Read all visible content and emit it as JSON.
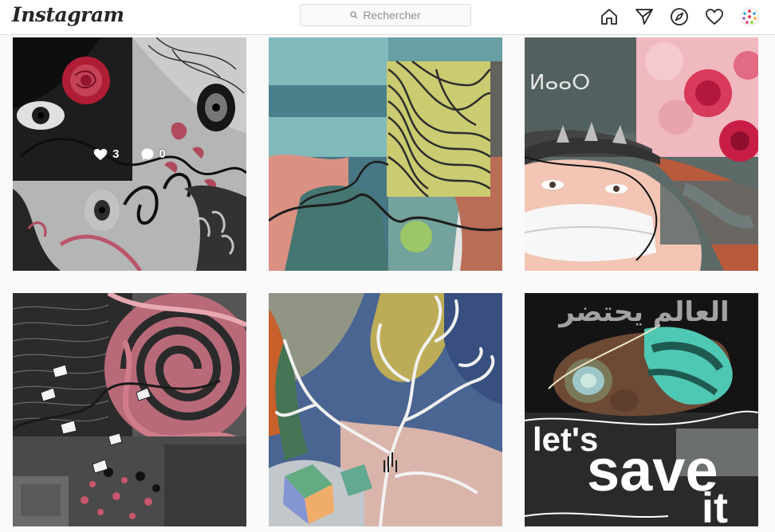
{
  "header": {
    "logo": "Instagram",
    "search_placeholder": "Rechercher"
  },
  "nav_icons": [
    "home-icon",
    "direct-send-icon",
    "explore-compass-icon",
    "activity-heart-icon",
    "profile-avatar"
  ],
  "posts": [
    {
      "name": "post-collage-rose-eyes",
      "likes": "3",
      "comments": "0"
    },
    {
      "name": "post-collage-zebra-face"
    },
    {
      "name": "post-collage-masked-woman-roses"
    },
    {
      "name": "post-collage-spiral-roses"
    },
    {
      "name": "post-collage-tree-branches"
    },
    {
      "name": "post-gasmask-save-it",
      "arabic_text": "العالم يحتضر",
      "caption_line1": "let's",
      "caption_line2": "save",
      "caption_line3": "it"
    }
  ]
}
